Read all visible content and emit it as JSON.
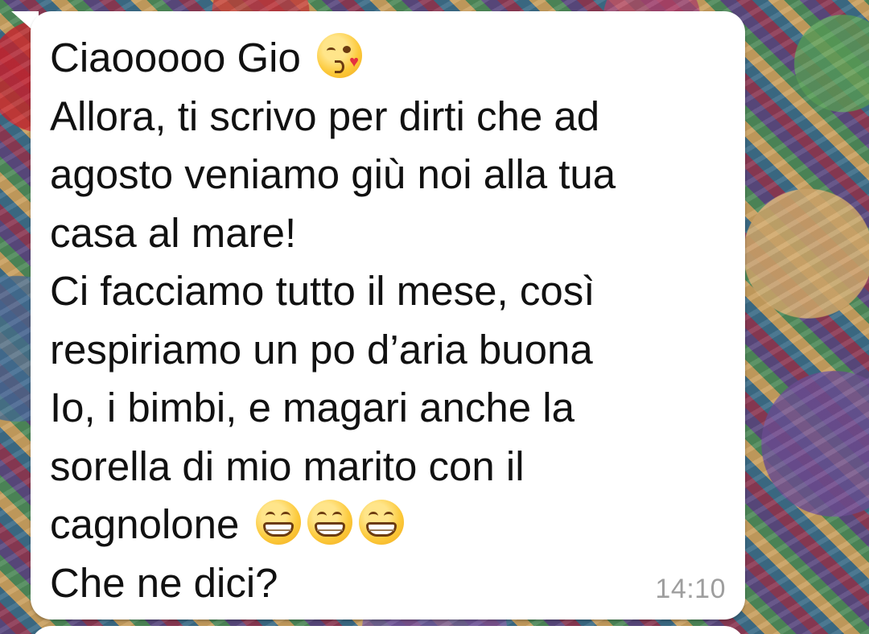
{
  "chat": {
    "message": {
      "lines": [
        "Ciaooooo Gio",
        "Allora, ti scrivo per dirti che ad",
        "agosto veniamo giù noi alla tua",
        "casa al mare!",
        "Ci facciamo tutto il mese, così",
        "respiriamo un po d’aria buona",
        "Io, i bimbi, e magari anche la",
        "sorella di mio marito con il",
        "cagnolone",
        "Che ne dici?"
      ],
      "emojis": {
        "line_0": [
          "kissing-face-with-heart-icon"
        ],
        "line_8": [
          "grinning-face-icon",
          "grinning-face-icon",
          "grinning-face-icon"
        ]
      },
      "time": "14:10"
    }
  },
  "colors": {
    "bubble": "#ffffff",
    "text": "#111111",
    "timestamp": "#9e9e9e"
  }
}
